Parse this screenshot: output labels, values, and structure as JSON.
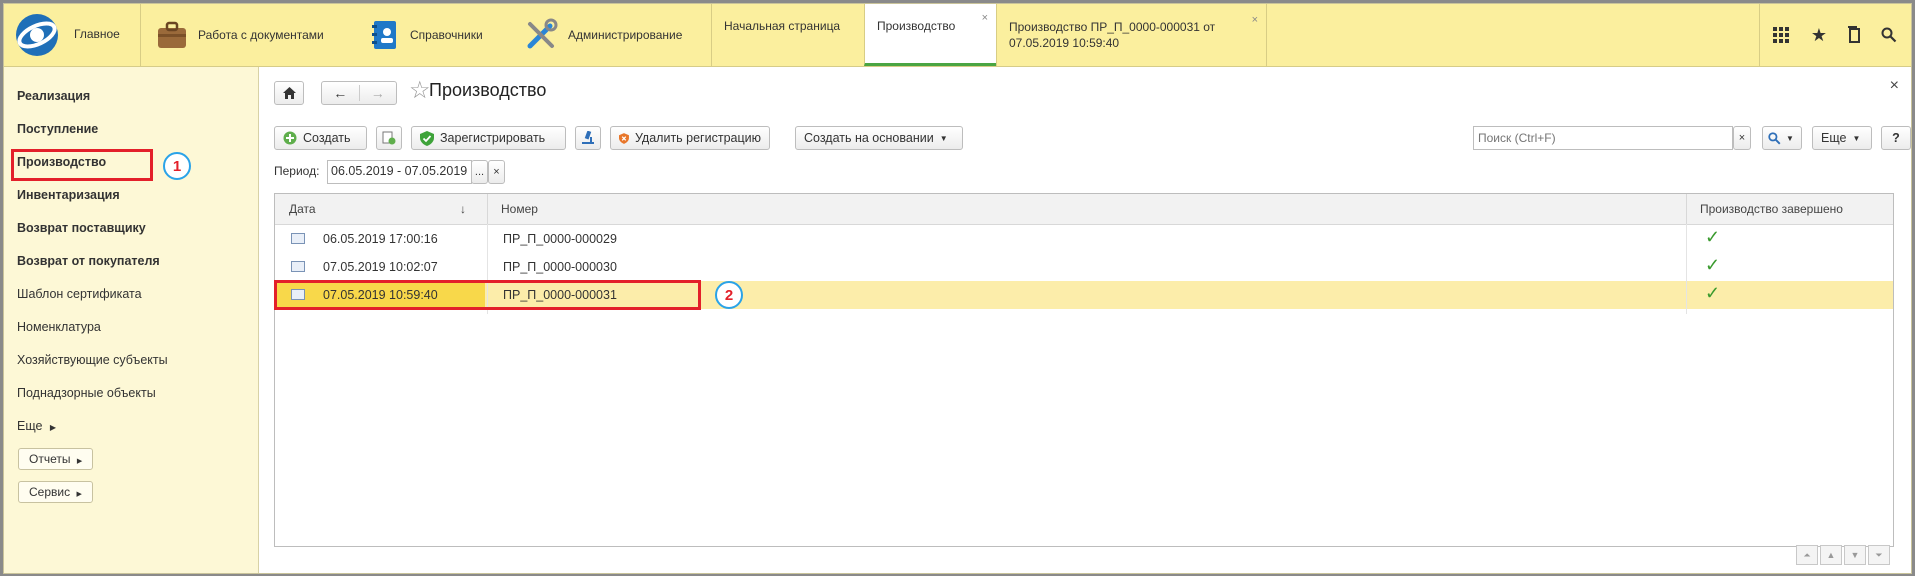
{
  "topbar": {
    "main": "Главное",
    "sections": [
      {
        "label": "Работа с документами"
      },
      {
        "label": "Справочники"
      },
      {
        "label": "Администрирование"
      }
    ],
    "tabs": [
      {
        "label": "Начальная страница"
      },
      {
        "label": "Производство"
      },
      {
        "label": "Производство ПР_П_0000-000031 от 07.05.2019 10:59:40"
      }
    ],
    "close_glyph": "×"
  },
  "sidebar": {
    "items": [
      "Реализация",
      "Поступление",
      "Производство",
      "Инвентаризация",
      "Возврат поставщику",
      "Возврат от покупателя",
      "Шаблон сертификата",
      "Номенклатура",
      "Хозяйствующие субъекты",
      "Поднадзорные объекты",
      "Еще"
    ],
    "reports": "Отчеты",
    "service": "Сервис"
  },
  "content": {
    "title": "Производство",
    "toolbar": {
      "create": "Создать",
      "register": "Зарегистрировать",
      "delete_registration": "Удалить регистрацию",
      "create_based": "Создать на основании",
      "more": "Еще",
      "help": "?"
    },
    "search": {
      "placeholder": "Поиск (Ctrl+F)"
    },
    "period": {
      "label": "Период:",
      "value": "06.05.2019 - 07.05.2019",
      "select": "...",
      "clear": "×"
    },
    "table": {
      "headers": [
        "Дата",
        "Номер",
        "Производство завершено"
      ],
      "sort_indicator": "↓",
      "rows": [
        {
          "date": "06.05.2019 17:00:16",
          "number": "ПР_П_0000-000029",
          "done": "✓"
        },
        {
          "date": "07.05.2019 10:02:07",
          "number": "ПР_П_0000-000030",
          "done": "✓"
        },
        {
          "date": "07.05.2019 10:59:40",
          "number": "ПР_П_0000-000031",
          "done": "✓"
        }
      ]
    }
  },
  "annotations": {
    "one": "1",
    "two": "2"
  },
  "colors": {
    "accent_red": "#e3202a",
    "accent_blue": "#2aa3e8",
    "check_green": "#3a9a2e",
    "topbar": "#fbef9e"
  }
}
